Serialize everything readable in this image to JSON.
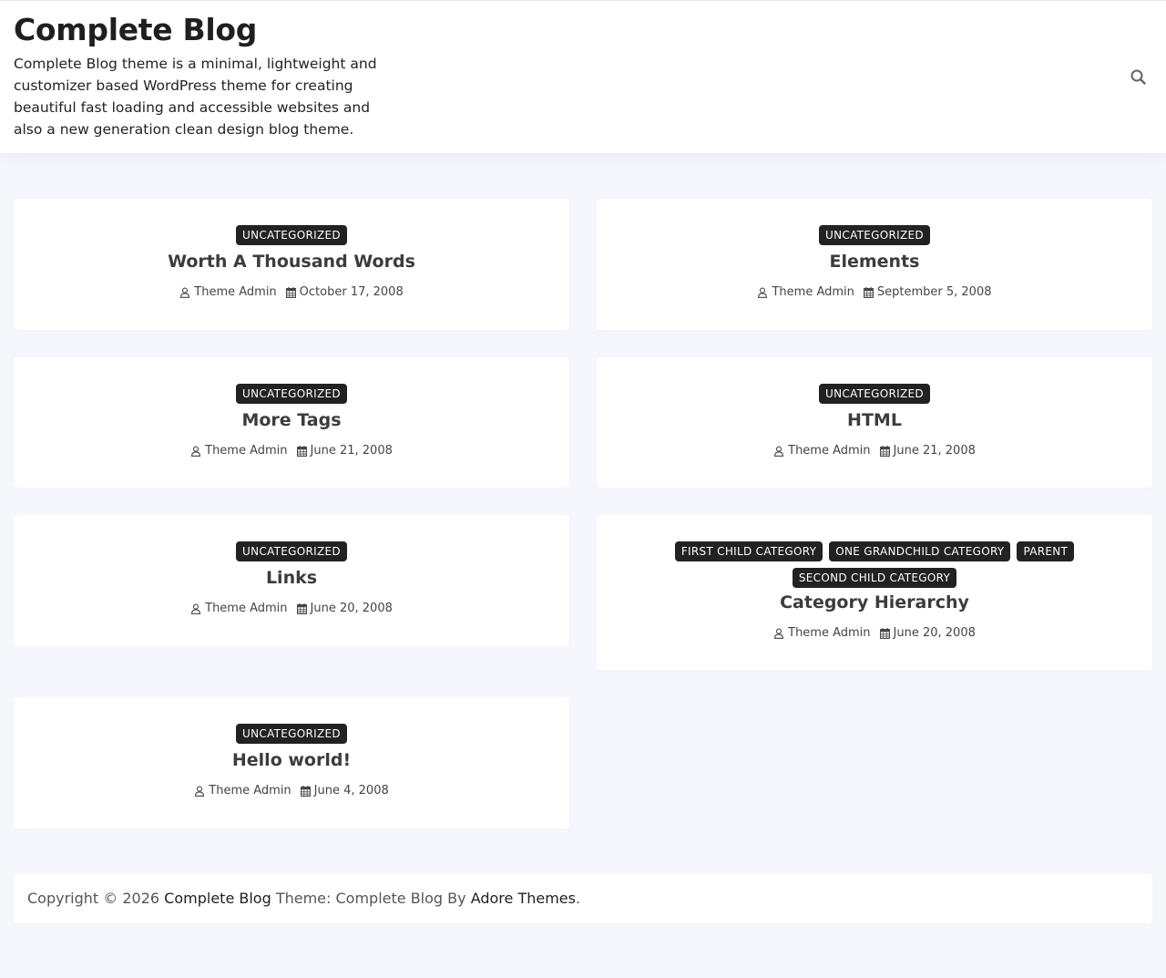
{
  "header": {
    "site_title": "Complete Blog",
    "site_description": "Complete Blog theme is a minimal, lightweight and customizer based WordPress theme for creating beautiful fast loading and accessible websites and also a new generation clean design blog theme."
  },
  "posts": [
    {
      "categories": [
        "UNCATEGORIZED"
      ],
      "title": "Worth A Thousand Words",
      "author": "Theme Admin",
      "date": "October 17, 2008"
    },
    {
      "categories": [
        "UNCATEGORIZED"
      ],
      "title": "Elements",
      "author": "Theme Admin",
      "date": "September 5, 2008"
    },
    {
      "categories": [
        "UNCATEGORIZED"
      ],
      "title": "More Tags",
      "author": "Theme Admin",
      "date": "June 21, 2008"
    },
    {
      "categories": [
        "UNCATEGORIZED"
      ],
      "title": "HTML",
      "author": "Theme Admin",
      "date": "June 21, 2008"
    },
    {
      "categories": [
        "UNCATEGORIZED"
      ],
      "title": "Links",
      "author": "Theme Admin",
      "date": "June 20, 2008"
    },
    {
      "categories": [
        "FIRST CHILD CATEGORY",
        "ONE GRANDCHILD CATEGORY",
        "PARENT",
        "SECOND CHILD CATEGORY"
      ],
      "title": "Category Hierarchy",
      "author": "Theme Admin",
      "date": "June 20, 2008"
    },
    {
      "categories": [
        "UNCATEGORIZED"
      ],
      "title": "Hello world!",
      "author": "Theme Admin",
      "date": "June 4, 2008"
    }
  ],
  "footer": {
    "copyright_prefix": "Copyright © 2026",
    "site_link": "Complete Blog",
    "theme_text": "Theme: Complete Blog By",
    "author_link": "Adore Themes",
    "suffix": "."
  },
  "icons": {
    "search": "search-icon",
    "author": "user-icon",
    "date": "calendar-icon"
  },
  "colors": {
    "background": "#f6f6fd",
    "card": "#ffffff",
    "badge": "#222222",
    "badge_text": "#ffffff",
    "title": "#3c3c3c"
  }
}
